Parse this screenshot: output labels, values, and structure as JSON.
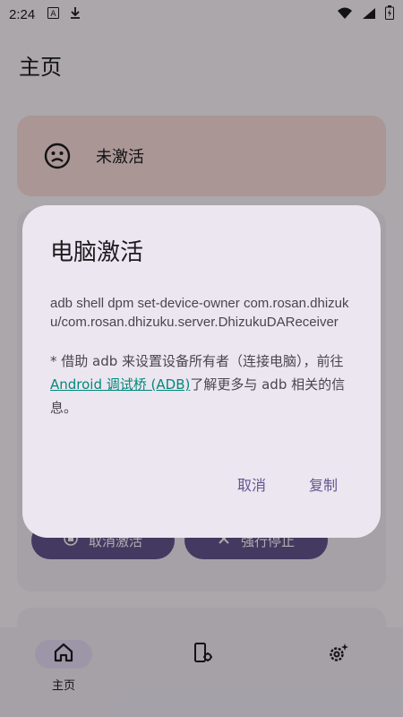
{
  "status_bar": {
    "time": "2:24",
    "icons": [
      "a-icon",
      "download-icon",
      "wifi-icon",
      "signal-icon",
      "battery-icon"
    ]
  },
  "app": {
    "title": "主页"
  },
  "status_card": {
    "label": "未激活"
  },
  "main_card": {
    "deactivate_label": "取消激活",
    "stop_label": "强行停止"
  },
  "bottom_nav": {
    "items": [
      {
        "label": "主页"
      },
      {
        "label": ""
      },
      {
        "label": ""
      }
    ]
  },
  "dialog": {
    "title": "电脑激活",
    "command": "adb shell dpm set-device-owner com.rosan.dhizuku/com.rosan.dhizuku.server.DhizukuDAReceiver",
    "note_prefix": "* 借助 adb 来设置设备所有者（连接电脑），前往",
    "note_link": "Android 调试桥 (ADB)",
    "note_suffix": "了解更多与 adb 相关的信息。",
    "cancel_label": "取消",
    "copy_label": "复制"
  },
  "colors": {
    "link": "#00897b",
    "accent": "#65558f",
    "surface": "#ece6f0"
  }
}
